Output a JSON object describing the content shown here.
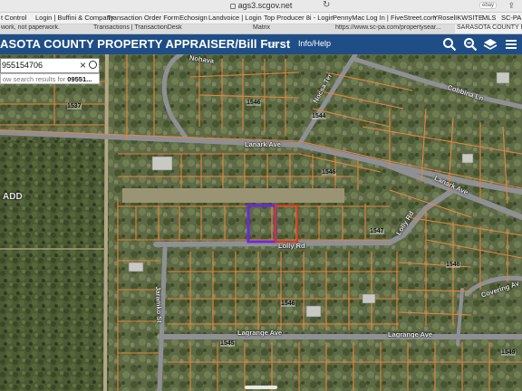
{
  "browser": {
    "url": "ags3.scgov.net",
    "ebay": "ebay"
  },
  "bookmarks": [
    "t Control",
    "Login | Buffini & Company",
    "Transaction Order Form",
    "Echosign",
    "Landvoice | Login",
    "Top Producer 8i - Login",
    "PennyMac",
    "Log In | FiveStreet.com",
    "YRoselIKWSITE",
    "MLS",
    "SC-PA"
  ],
  "tabs": [
    "work, not paperwork.",
    "Transactions | TransactionDesk",
    "Matrix",
    "https://www.sc-pa.com/propertysear...",
    "SARASOTA COUNTY PROPER"
  ],
  "app": {
    "title": "ASOTA COUNTY PROPERTY APPRAISER/Bill Furst",
    "version": "v2.8",
    "help": "Info/Help",
    "icons": [
      "search-icon",
      "zoom-icon",
      "layers-icon",
      "menu-icon"
    ]
  },
  "search": {
    "value": "955154706",
    "suggestion_prefix": "ow search results for ",
    "suggestion_term": "09551..."
  },
  "map": {
    "roads": {
      "nohava": "Nohava",
      "cobbina": "Cobbina Ln",
      "nocsa": "Nocsa Ter",
      "lanark1": "Lanark Ave",
      "lanark2": "Lanark Ave",
      "lolly": "Lolly Rd",
      "lolly2": "Lolly Rd",
      "jaramko": "Jaramko St",
      "lagrange1": "Lagrange Ave",
      "lagrange2": "Lagrange Ave",
      "covering": "Covering Av",
      "add": "ADD"
    },
    "parcels": {
      "p1537": "1537",
      "p1546a": "1546",
      "p1544": "1544",
      "p1546b": "1546",
      "p1547": "1547",
      "p1548": "1548",
      "p1546c": "1546",
      "p1545": "1545",
      "p1549": "1549"
    },
    "colors": {
      "boundary": "#e8843a",
      "selected": "#6a2bd6",
      "adjacent": "#d9361c",
      "roads": "#8f9096"
    }
  }
}
